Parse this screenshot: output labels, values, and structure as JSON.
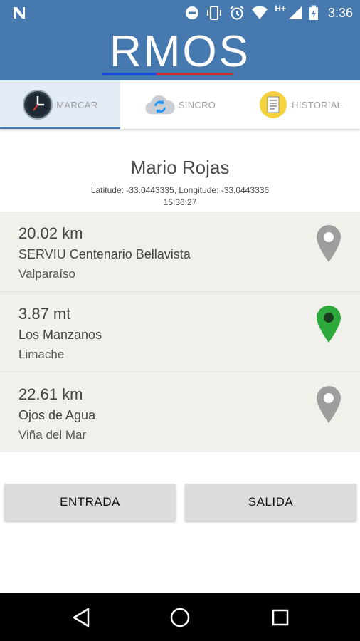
{
  "status_bar": {
    "time": "3:36",
    "network_label": "H+",
    "icons": [
      "notification-n-icon",
      "do-not-disturb-icon",
      "vibrate-icon",
      "alarm-icon",
      "wifi-icon",
      "cell-signal-icon",
      "battery-charging-icon"
    ]
  },
  "header": {
    "logo_text": "RMOS",
    "background_color": "#4579b0",
    "logo_underline_colors": [
      "#1e4fd8",
      "#d7263d"
    ]
  },
  "tabs": [
    {
      "label": "MARCAR",
      "icon": "clock-icon",
      "active": true
    },
    {
      "label": "SINCRO",
      "icon": "cloud-sync-icon",
      "active": false
    },
    {
      "label": "HISTORIAL",
      "icon": "history-list-icon",
      "active": false
    }
  ],
  "user": {
    "name": "Mario Rojas",
    "coordinates": "Latitude: -33.0443335, Longitude: -33.0443336",
    "time": "15:36:27"
  },
  "locations": [
    {
      "distance": "20.02 km",
      "place": "SERVIU Centenario Bellavista",
      "city": "Valparaíso",
      "pin_color": "#9e9e9e"
    },
    {
      "distance": "3.87 mt",
      "place": "Los Manzanos",
      "city": "Limache",
      "pin_color": "#2eaa3c"
    },
    {
      "distance": "22.61 km",
      "place": "Ojos de Agua",
      "city": "Viña del Mar",
      "pin_color": "#9e9e9e"
    }
  ],
  "actions": {
    "entrada_label": "ENTRADA",
    "salida_label": "SALIDA"
  },
  "nav_bar": {
    "icons": [
      "back-icon",
      "home-icon",
      "recents-icon"
    ]
  }
}
